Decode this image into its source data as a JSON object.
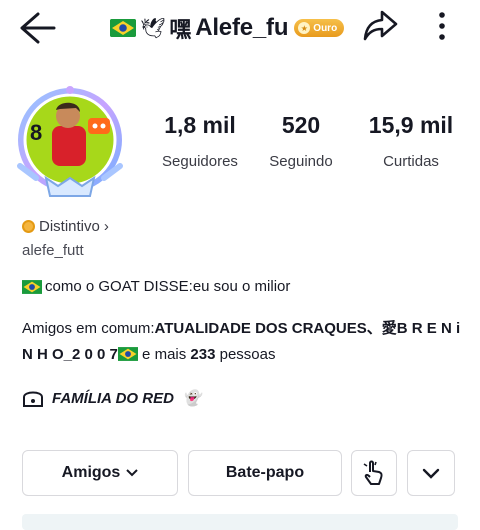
{
  "header": {
    "title_prefix": "🇧🇷🕊️嘿",
    "title": "Alefe_fu",
    "badge": "Ouro"
  },
  "stats": [
    {
      "value": "1,8 mil",
      "label": "Seguidores"
    },
    {
      "value": "520",
      "label": "Seguindo"
    },
    {
      "value": "15,9 mil",
      "label": "Curtidas"
    }
  ],
  "distintivo": "Distintivo",
  "username": "alefe_futt",
  "bio": "como o GOAT DISSE:eu sou o milior",
  "mutual": {
    "prefix": "Amigos em comum:",
    "names": "ATUALIDADE DOS CRAQUES、愛B R E N i N H O_2 0 0 7",
    "and_more": " e mais ",
    "count": "233",
    "suffix": " pessoas"
  },
  "family": "FAMÍLIA DO RED",
  "family_emoji": "👻",
  "actions": {
    "amigos": "Amigos",
    "chat": "Bate-papo"
  },
  "icons": {
    "back": "arrow-left-icon",
    "share": "share-arrow-icon",
    "more": "more-vertical-icon",
    "chevron": "chevron-down-icon",
    "hand": "hand-pointer-icon"
  }
}
